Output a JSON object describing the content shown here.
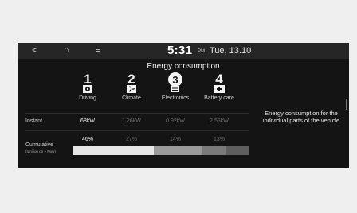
{
  "status_bar": {
    "back_glyph": "<",
    "home_glyph": "⌂",
    "menu_glyph": "≡",
    "time": "5:31",
    "ampm": "PM",
    "date": "Tue, 13.10"
  },
  "title": "Energy consumption",
  "categories": [
    {
      "number": "1",
      "label": "Driving",
      "icon": "steering-wheel-icon"
    },
    {
      "number": "2",
      "label": "Climate",
      "icon": "fan-icon"
    },
    {
      "number": "3",
      "label": "Electronics",
      "icon": "bulb-icon"
    },
    {
      "number": "4",
      "label": "Battery care",
      "icon": "battery-icon"
    }
  ],
  "instant": {
    "label": "Instant",
    "values": [
      "68kW",
      "1.26kW",
      "0.92kW",
      "2.55kW"
    ]
  },
  "cumulative": {
    "label": "Cumulative",
    "sublabel": "(Ignition on ~ Now)",
    "percents": [
      "46%",
      "27%",
      "14%",
      "13%"
    ],
    "shares": [
      0.46,
      0.27,
      0.14,
      0.13
    ],
    "colors": [
      "#e6e6e6",
      "#9a9a9a",
      "#7a7a7a",
      "#5e5e5e"
    ]
  },
  "description": "Energy consumption for the individual parts of the vehicle",
  "colors": {
    "screen_bg": "#141414",
    "status_bg": "#262626",
    "accent": "#f0f0f0"
  }
}
